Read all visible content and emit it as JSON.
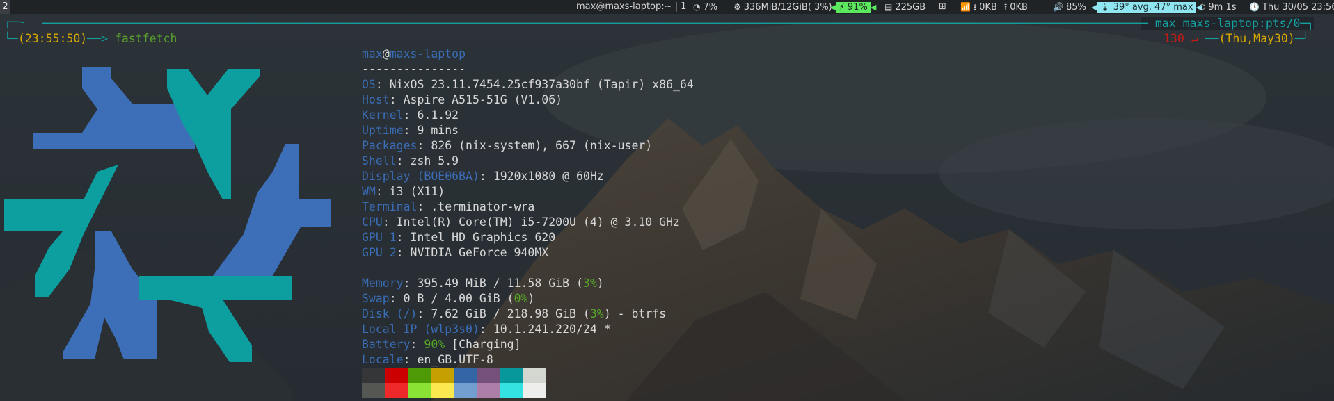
{
  "bar": {
    "workspace": "2",
    "window_title": "max@maxs-laptop:~ | 1",
    "cpu": "7%",
    "memory": "336MiB/12GiB( 3%)",
    "battery": "91%",
    "disk": "225GB",
    "net_down": "0KB",
    "net_up": "0KB",
    "volume": "85%",
    "temperature": "39° avg, 47° max",
    "uptime": "9m 1s",
    "clock": "Thu 30/05 23:56"
  },
  "prompt": {
    "cwd": "~",
    "time": "(23:55:50)",
    "arrow": "─>",
    "command": "fastfetch",
    "user_host": "max maxs-laptop:pts/0",
    "exit_code": "130 ↵",
    "date": "(Thu,May30)"
  },
  "fetch": {
    "user": "max",
    "at": "@",
    "host": "maxs-laptop",
    "separator": "---------------",
    "lines": [
      {
        "key": "OS",
        "value": "NixOS 23.11.7454.25cf937a30bf (Tapir) x86_64"
      },
      {
        "key": "Host",
        "value": "Aspire A515-51G (V1.06)"
      },
      {
        "key": "Kernel",
        "value": "6.1.92"
      },
      {
        "key": "Uptime",
        "value": "9 mins"
      },
      {
        "key": "Packages",
        "value": "826 (nix-system), 667 (nix-user)"
      },
      {
        "key": "Shell",
        "value": "zsh 5.9"
      },
      {
        "key": "Display (BOE06BA)",
        "value": "1920x1080 @ 60Hz"
      },
      {
        "key": "WM",
        "value": "i3 (X11)"
      },
      {
        "key": "Terminal",
        "value": ".terminator-wra"
      },
      {
        "key": "CPU",
        "value": "Intel(R) Core(TM) i5-7200U (4) @ 3.10 GHz"
      },
      {
        "key": "GPU 1",
        "value": "Intel HD Graphics 620"
      },
      {
        "key": "GPU 2",
        "value": "NVIDIA GeForce 940MX"
      }
    ],
    "memory": {
      "key": "Memory",
      "value": "395.49 MiB / 11.58 GiB (",
      "pct": "3%",
      "tail": ")"
    },
    "swap": {
      "key": "Swap",
      "value": "0 B / 4.00 GiB (",
      "pct": "0%",
      "tail": ")"
    },
    "disk": {
      "key": "Disk (/)",
      "value": "7.62 GiB / 218.98 GiB (",
      "pct": "3%",
      "tail": ") - btrfs"
    },
    "local_ip": {
      "key": "Local IP (wlp3s0)",
      "value": "10.1.241.220/24 *"
    },
    "battery": {
      "key": "Battery",
      "pct": "90%",
      "value": " [Charging]"
    },
    "locale": {
      "key": "Locale",
      "value": "en_GB.UTF-8"
    },
    "palette_top": [
      "#343638",
      "#cc0000",
      "#4e9a06",
      "#c4a000",
      "#3465a4",
      "#75507b",
      "#06989a",
      "#d3d7cf"
    ],
    "palette_bottom": [
      "#555753",
      "#ef2929",
      "#8ae234",
      "#fce94f",
      "#729fcf",
      "#ad7fa8",
      "#34e2e2",
      "#eeeeec"
    ]
  },
  "colors": {
    "logo_blue": "#3d6fb8",
    "logo_teal": "#0d9ea0"
  }
}
